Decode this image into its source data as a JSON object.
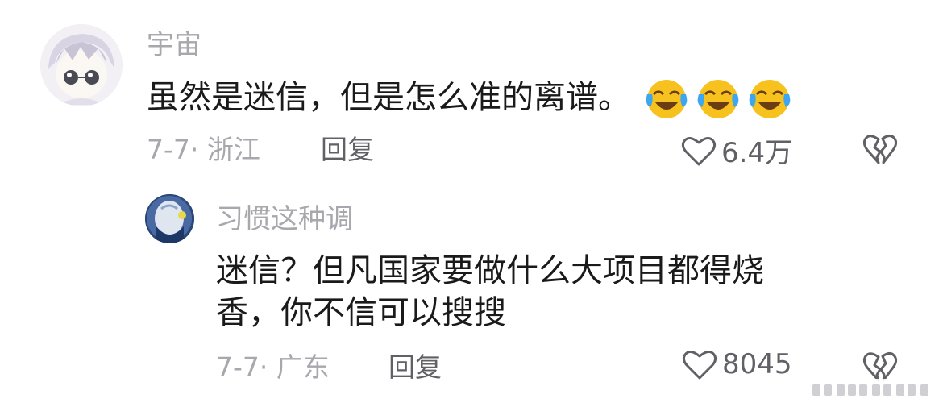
{
  "comments": [
    {
      "username": "宇宙",
      "text": "虽然是迷信，但是怎么准的离谱。",
      "emojis": [
        "laughing-crying-emoji",
        "laughing-crying-emoji",
        "laughing-crying-emoji"
      ],
      "meta": "7-7· 浙江",
      "reply_label": "回复",
      "like_count": "6.4万"
    },
    {
      "username": "习惯这种调",
      "text_lines": [
        "迷信？但凡国家要做什么大项目都得烧",
        "香，你不信可以搜搜"
      ],
      "meta": "7-7· 广东",
      "reply_label": "回复",
      "like_count": "8045"
    }
  ],
  "colors": {
    "username": "#a7a7ad",
    "content": "#1a1a1a",
    "meta": "#a7a7ad",
    "action": "#606066",
    "emoji_face": "#f7c21d"
  },
  "icons": [
    "heart-icon",
    "broken-heart-icon"
  ]
}
